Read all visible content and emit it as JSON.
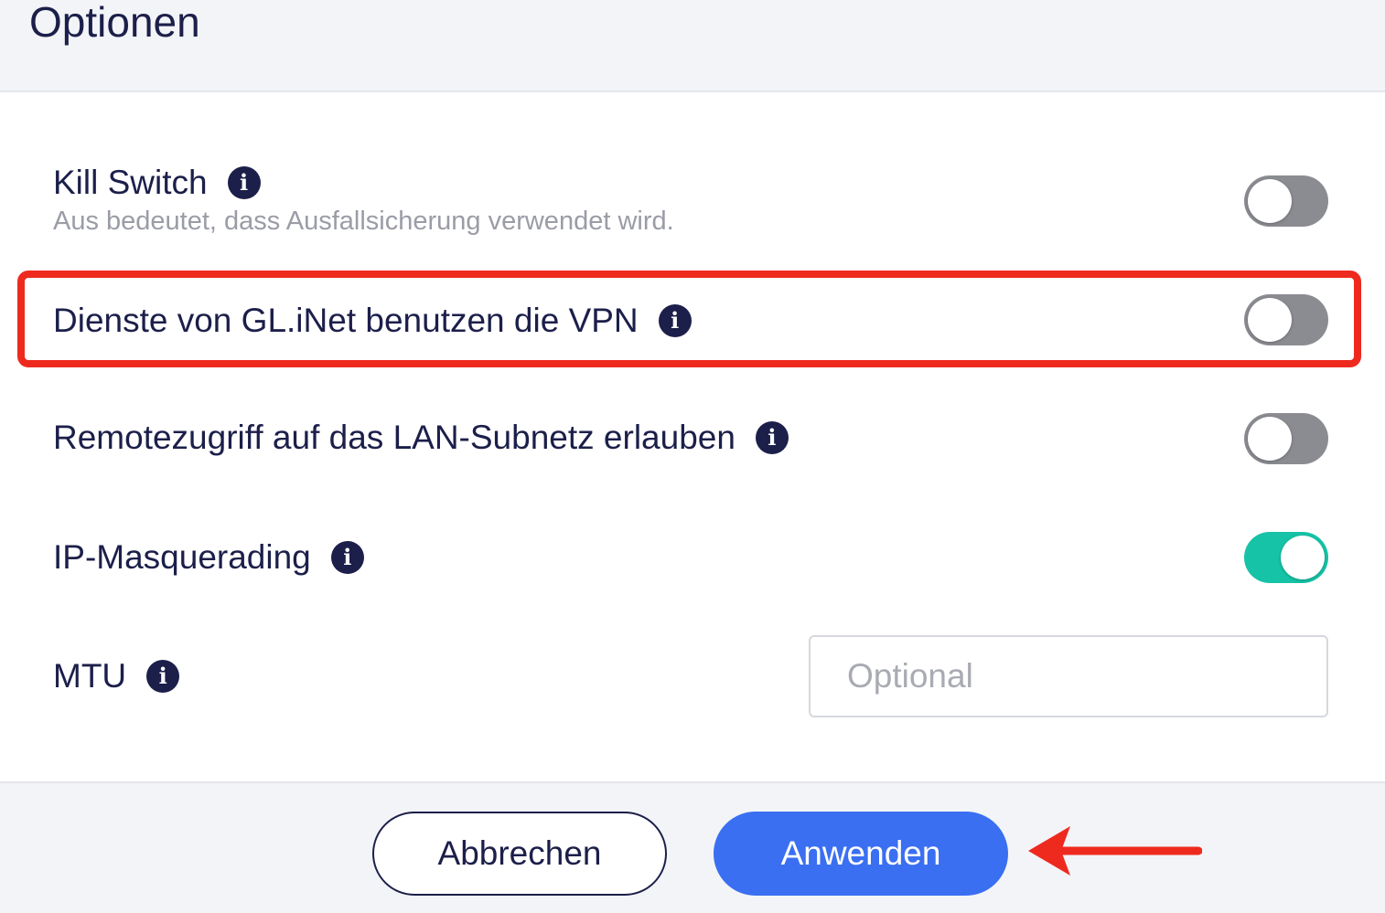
{
  "header": {
    "title": "Optionen"
  },
  "options": {
    "kill_switch": {
      "label": "Kill Switch",
      "description": "Aus bedeutet, dass Ausfallsicherung verwendet wird.",
      "enabled": false
    },
    "glinet_services": {
      "label": "Dienste von GL.iNet benutzen die VPN",
      "enabled": false
    },
    "remote_lan": {
      "label": "Remotezugriff auf das LAN-Subnetz erlauben",
      "enabled": false
    },
    "ip_masquerading": {
      "label": "IP-Masquerading",
      "enabled": true
    },
    "mtu": {
      "label": "MTU",
      "value": "",
      "placeholder": "Optional"
    }
  },
  "icons": {
    "info": "info-icon"
  },
  "footer": {
    "cancel_label": "Abbrechen",
    "apply_label": "Anwenden"
  },
  "colors": {
    "toggle_on": "#16c3a6",
    "toggle_off": "#8a8c91",
    "primary_button": "#3a6ff2",
    "annotation_red": "#ee2a1f",
    "text_dark": "#1c1f4a"
  }
}
